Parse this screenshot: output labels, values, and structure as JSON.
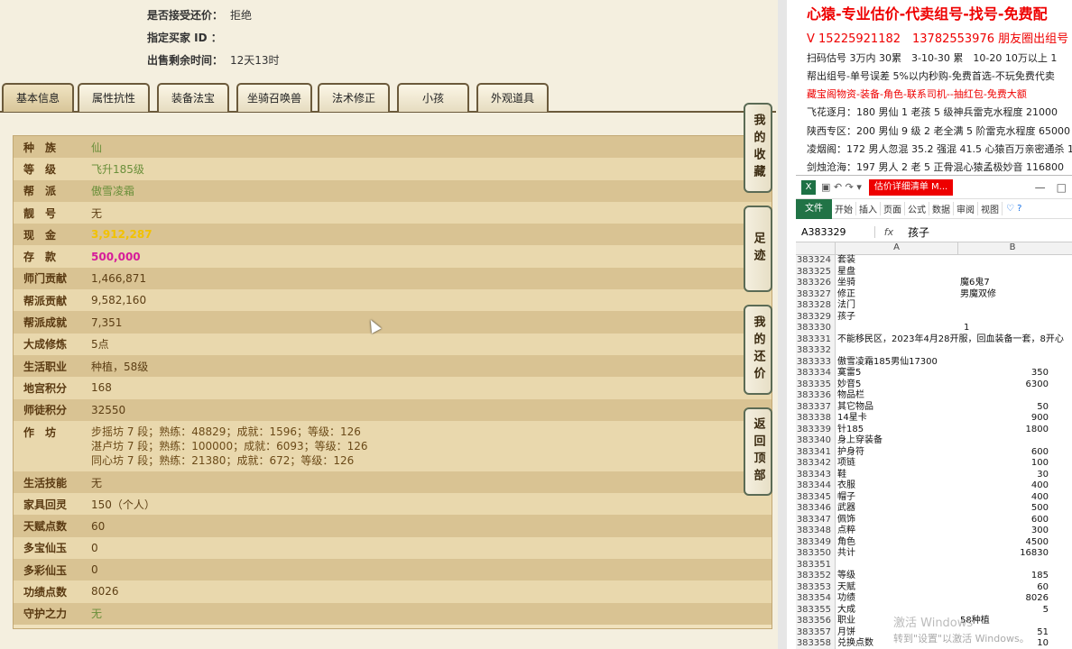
{
  "info": {
    "accept_label": "是否接受还价：",
    "accept_value": "拒绝",
    "buyer_label": "指定买家 ID ：",
    "buyer_value": "",
    "remain_label": "出售剩余时间：",
    "remain_value": "12天13时"
  },
  "tabs": [
    "基本信息",
    "属性抗性",
    "装备法宝",
    "坐骑召唤兽",
    "法术修正",
    "小孩",
    "外观道具"
  ],
  "side_buttons": [
    "我的收藏",
    "足迹",
    "我的还价",
    "返回顶部"
  ],
  "rows": [
    {
      "k": "种　族",
      "v": "仙",
      "color": "#6a8f3a"
    },
    {
      "k": "等　级",
      "v": "飞升185级",
      "color": "#6a8f3a"
    },
    {
      "k": "帮　派",
      "v": "傲雪凌霜",
      "color": "#6a8f3a"
    },
    {
      "k": "靓　号",
      "v": "无",
      "color": "#5c3e14"
    },
    {
      "k": "现　金",
      "v": "3,912,287",
      "color": "#f2c200"
    },
    {
      "k": "存　款",
      "v": "500,000",
      "color": "#d61c9a"
    },
    {
      "k": "师门贡献",
      "v": "1,466,871",
      "color": "#5c3e14"
    },
    {
      "k": "帮派贡献",
      "v": "9,582,160",
      "color": "#5c3e14"
    },
    {
      "k": "帮派成就",
      "v": "7,351",
      "color": "#5c3e14"
    },
    {
      "k": "大成修炼",
      "v": "5点",
      "color": "#5c3e14"
    },
    {
      "k": "生活职业",
      "v": "种植，58级",
      "color": "#5c3e14"
    },
    {
      "k": "地宫积分",
      "v": "168",
      "color": "#5c3e14"
    },
    {
      "k": "师徒积分",
      "v": "32550",
      "color": "#5c3e14"
    }
  ],
  "workshop": {
    "k": "作　坊",
    "lines": [
      "步摇坊 7 段；熟练：48829；成就：1596；等级：126",
      "湛卢坊 7 段；熟练：100000；成就：6093；等级：126",
      "同心坊 7 段；熟练：21380；成就：672；等级：126"
    ]
  },
  "rows2": [
    {
      "k": "生活技能",
      "v": "无",
      "color": "#5c3e14"
    },
    {
      "k": "家具回灵",
      "v": "150（个人）",
      "color": "#5c3e14"
    },
    {
      "k": "天赋点数",
      "v": "60",
      "color": "#5c3e14"
    },
    {
      "k": "多宝仙玉",
      "v": "0",
      "color": "#5c3e14"
    },
    {
      "k": "多彩仙玉",
      "v": "0",
      "color": "#5c3e14"
    },
    {
      "k": "功绩点数",
      "v": "8026",
      "color": "#5c3e14"
    },
    {
      "k": "守护之力",
      "v": "无",
      "color": "#6a8f3a"
    }
  ],
  "ad": {
    "title": "心猿-专业估价-代卖组号-找号-免费配",
    "phone": "V 15225921182　13782553976 朋友圈出组号",
    "line1": "扫码估号 3万内 30累　3-10-30 累　10-20 10万以上 1",
    "line2": "帮出组号-单号误差 5%以内秒购-免费首选-不玩免费代卖",
    "line3": "藏宝阁物资-装备-角色-联系司机--抽红包-免费大额",
    "line4": "飞花逐月：180 男仙 1 老孩 5 级神兵雷克水程度 21000",
    "line5": "陕西专区：200 男仙 9 级 2 老全满 5 阶雷克水程度 65000",
    "line6": "凌烟阁：172 男人忽混 35.2 强混 41.5 心猿百万亲密通杀 19",
    "line7": "剑烛沧海：197 男人 2 老 5 正骨混心猿孟极妙音 116800"
  },
  "excel": {
    "title_tab": "估价详细清单 M...",
    "ribbon": [
      "开始",
      "插入",
      "页面",
      "公式",
      "数据",
      "审阅",
      "视图"
    ],
    "file_tab": "文件",
    "namebox": "A383329",
    "formula": "孩子",
    "col_a": "A",
    "col_b": "B",
    "rows": [
      {
        "n": "383324",
        "a": "套装",
        "b": ""
      },
      {
        "n": "383325",
        "a": "星盘",
        "b": ""
      },
      {
        "n": "383326",
        "a": "坐骑",
        "b": "魔6鬼7",
        "bl": true
      },
      {
        "n": "383327",
        "a": "修正",
        "b": "男魔双修",
        "bl": true
      },
      {
        "n": "383328",
        "a": "法门",
        "b": ""
      },
      {
        "n": "383329",
        "a": "孩子",
        "b": ""
      },
      {
        "n": "383330",
        "a": "　　　　　　　　　　　　　　1",
        "b": ""
      },
      {
        "n": "383331",
        "a": "不能移民区，2023年4月28开服，回血装备一套，8开心",
        "b": ""
      },
      {
        "n": "383332",
        "a": "",
        "b": ""
      },
      {
        "n": "383333",
        "a": "傲雪凌霜185男仙17300",
        "b": ""
      },
      {
        "n": "383334",
        "a": "寞雷5",
        "b": "350"
      },
      {
        "n": "383335",
        "a": "妙音5",
        "b": "6300"
      },
      {
        "n": "383336",
        "a": "物品栏",
        "b": ""
      },
      {
        "n": "383337",
        "a": "其它物品",
        "b": "50"
      },
      {
        "n": "383338",
        "a": "14星卡",
        "b": "900"
      },
      {
        "n": "383339",
        "a": "针185",
        "b": "1800"
      },
      {
        "n": "383340",
        "a": "身上穿装备",
        "b": ""
      },
      {
        "n": "383341",
        "a": "护身符",
        "b": "600"
      },
      {
        "n": "383342",
        "a": "项链",
        "b": "100"
      },
      {
        "n": "383343",
        "a": "鞋",
        "b": "30"
      },
      {
        "n": "383344",
        "a": "衣服",
        "b": "400"
      },
      {
        "n": "383345",
        "a": "帽子",
        "b": "400"
      },
      {
        "n": "383346",
        "a": "武器",
        "b": "500"
      },
      {
        "n": "383347",
        "a": "佩饰",
        "b": "600"
      },
      {
        "n": "383348",
        "a": "点粹",
        "b": "300"
      },
      {
        "n": "383349",
        "a": "角色",
        "b": "4500"
      },
      {
        "n": "383350",
        "a": "共计",
        "b": "16830"
      },
      {
        "n": "383351",
        "a": "",
        "b": ""
      },
      {
        "n": "383352",
        "a": "等级",
        "b": "185"
      },
      {
        "n": "383353",
        "a": "天赋",
        "b": "60"
      },
      {
        "n": "383354",
        "a": "功绩",
        "b": "8026"
      },
      {
        "n": "383355",
        "a": "大成",
        "b": "5"
      },
      {
        "n": "383356",
        "a": "职业",
        "b": "58种植",
        "bl": true
      },
      {
        "n": "383357",
        "a": "月饼",
        "b": "51"
      },
      {
        "n": "383358",
        "a": "兑换点数",
        "b": "10"
      }
    ]
  },
  "watermark": {
    "line1": "激活 Windows",
    "line2": "转到\"设置\"以激活 Windows。"
  }
}
